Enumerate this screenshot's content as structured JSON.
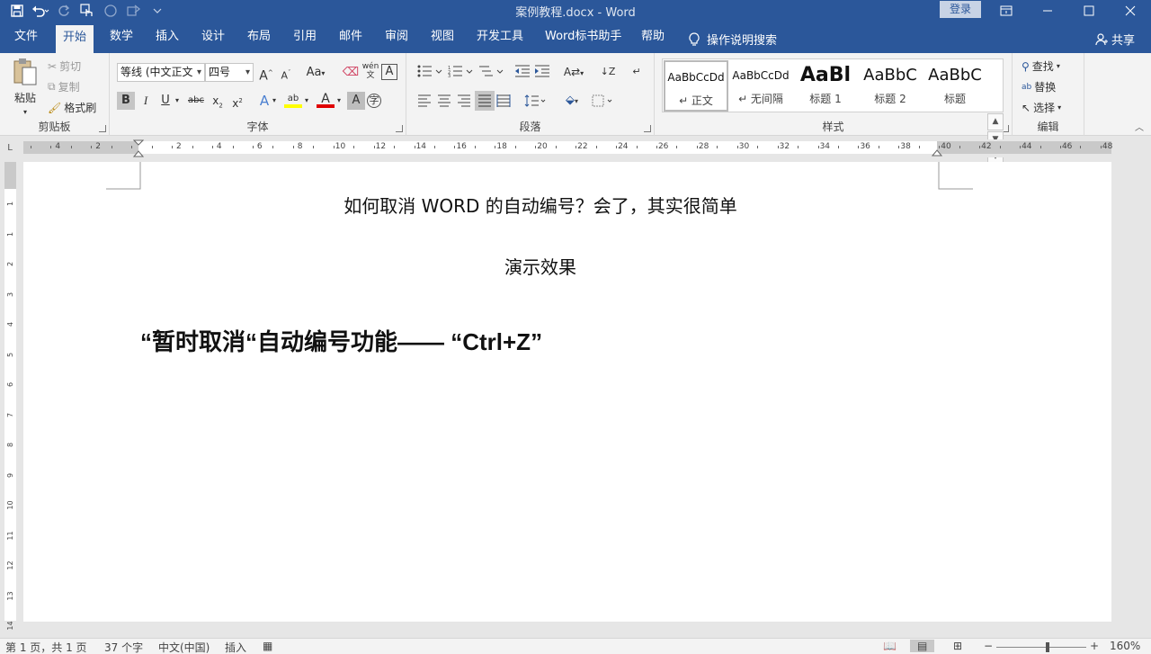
{
  "titlebar": {
    "title": "案例教程.docx  -  Word",
    "login": "登录"
  },
  "tabs": [
    {
      "label": "文件"
    },
    {
      "label": "开始"
    },
    {
      "label": "数学"
    },
    {
      "label": "插入"
    },
    {
      "label": "设计"
    },
    {
      "label": "布局"
    },
    {
      "label": "引用"
    },
    {
      "label": "邮件"
    },
    {
      "label": "审阅"
    },
    {
      "label": "视图"
    },
    {
      "label": "开发工具"
    },
    {
      "label": "Word标书助手"
    },
    {
      "label": "帮助"
    }
  ],
  "active_tab": "开始",
  "tell_me": "操作说明搜索",
  "share": "共享",
  "ribbon": {
    "clipboard": {
      "label": "剪贴板",
      "paste": "粘贴",
      "cut": "剪切",
      "copy": "复制",
      "format_painter": "格式刷"
    },
    "font": {
      "label": "字体",
      "font_name": "等线 (中文正文",
      "font_size": "四号",
      "aa": "Aa",
      "wen": "wén",
      "wen_char": "文"
    },
    "paragraph": {
      "label": "段落"
    },
    "styles": {
      "label": "样式",
      "items": [
        {
          "preview": "AaBbCcDd",
          "name": "↵ 正文"
        },
        {
          "preview": "AaBbCcDd",
          "name": "↵ 无间隔"
        },
        {
          "preview": "AaBl",
          "name": "标题 1"
        },
        {
          "preview": "AaBbC",
          "name": "标题 2"
        },
        {
          "preview": "AaBbC",
          "name": "标题"
        }
      ]
    },
    "editing": {
      "label": "编辑",
      "find": "查找",
      "replace": "替换",
      "select": "选择"
    }
  },
  "ruler": {
    "numbers": [
      "4",
      "2",
      "2",
      "4",
      "6",
      "8",
      "10",
      "12",
      "14",
      "16",
      "18",
      "20",
      "22",
      "24",
      "26",
      "28",
      "30",
      "32",
      "34",
      "36",
      "38",
      "40",
      "42",
      "44",
      "46",
      "48"
    ],
    "vnumbers": [
      "1",
      "1",
      "2",
      "3",
      "4",
      "5",
      "6",
      "7",
      "8",
      "9",
      "10",
      "11",
      "12",
      "13",
      "14"
    ]
  },
  "document": {
    "title": "如何取消 WORD 的自动编号？会了，其实很简单",
    "subtitle": "演示效果",
    "heading": "“暂时取消“自动编号功能—— “Ctrl+Z”"
  },
  "statusbar": {
    "page": "第 1 页，共 1 页",
    "words": "37 个字",
    "language": "中文(中国)",
    "mode": "插入",
    "zoom": "160%",
    "zoom_minus": "−",
    "zoom_plus": "+"
  },
  "colors": {
    "brand": "#2b579a",
    "ribbon_bg": "#f3f3f3",
    "highlight": "#ffff00",
    "font_color": "#e00000"
  }
}
